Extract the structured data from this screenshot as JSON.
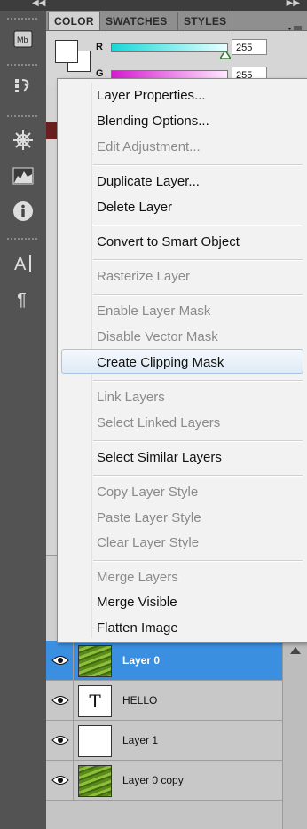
{
  "colors": {
    "accent_selected": "#3b8fe0",
    "slider_r": "#2fe0e0",
    "slider_g": "#e02fd6",
    "menu_bg": "#f2f2f2"
  },
  "left_tools": [
    "mini-bridge-icon",
    "history-icon",
    "navigator-icon",
    "histogram-icon",
    "info-icon",
    "character-icon",
    "paragraph-icon"
  ],
  "color_panel": {
    "tabs": [
      "COLOR",
      "SWATCHES",
      "STYLES"
    ],
    "active_tab": "COLOR",
    "r_label": "R",
    "g_label": "G",
    "r_value": "255",
    "g_value": "255"
  },
  "context_menu": {
    "items": [
      {
        "label": "Layer Properties...",
        "enabled": true
      },
      {
        "label": "Blending Options...",
        "enabled": true
      },
      {
        "label": "Edit Adjustment...",
        "enabled": false
      },
      {
        "label": "Duplicate Layer...",
        "enabled": true
      },
      {
        "label": "Delete Layer",
        "enabled": true
      },
      {
        "label": "Convert to Smart Object",
        "enabled": true
      },
      {
        "label": "Rasterize Layer",
        "enabled": false
      },
      {
        "label": "Enable Layer Mask",
        "enabled": false
      },
      {
        "label": "Disable Vector Mask",
        "enabled": false
      },
      {
        "label": "Create Clipping Mask",
        "enabled": true,
        "highlighted": true
      },
      {
        "label": "Link Layers",
        "enabled": false
      },
      {
        "label": "Select Linked Layers",
        "enabled": false
      },
      {
        "label": "Select Similar Layers",
        "enabled": true
      },
      {
        "label": "Copy Layer Style",
        "enabled": false
      },
      {
        "label": "Paste Layer Style",
        "enabled": false
      },
      {
        "label": "Clear Layer Style",
        "enabled": false
      },
      {
        "label": "Merge Layers",
        "enabled": false
      },
      {
        "label": "Merge Visible",
        "enabled": true
      },
      {
        "label": "Flatten Image",
        "enabled": true
      }
    ]
  },
  "layers": [
    {
      "name": "Layer 0",
      "selected": true,
      "thumb": "grass"
    },
    {
      "name": "HELLO",
      "selected": false,
      "thumb": "text",
      "thumb_glyph": "T"
    },
    {
      "name": "Layer 1",
      "selected": false,
      "thumb": "blank"
    },
    {
      "name": "Layer 0 copy",
      "selected": false,
      "thumb": "grass"
    }
  ]
}
